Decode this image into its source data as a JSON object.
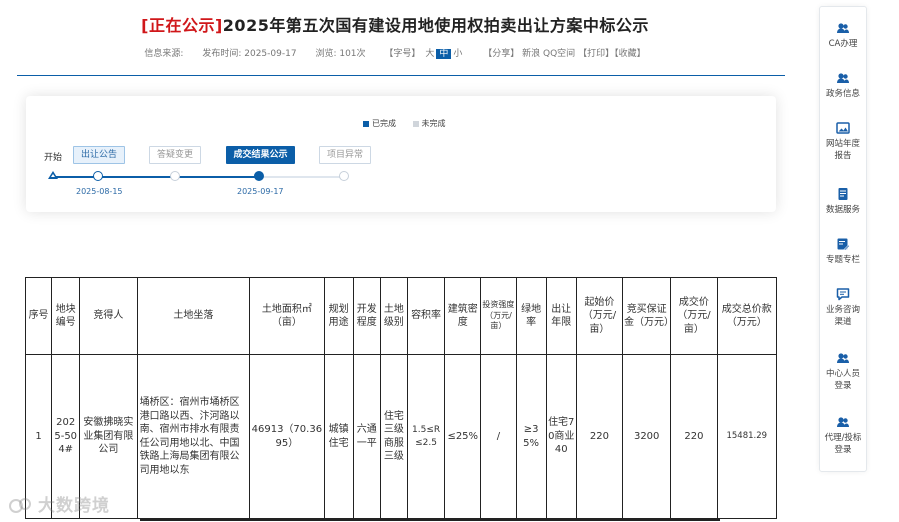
{
  "article": {
    "tag": "[正在公示]",
    "title": "2025年第五次国有建设用地使用权拍卖出让方案中标公示",
    "source_label": "信息来源:",
    "publish_label": "发布时间:",
    "publish_date": "2025-09-17",
    "views_label": "浏览:",
    "views": "101次",
    "font_size_label": "【字号】",
    "font_large": "大",
    "font_medium": "中",
    "font_small": "小",
    "share_label": "【分享】",
    "share_sina": "新浪",
    "share_qq": "QQ空间",
    "print_label": "【打印】",
    "fav_label": "【收藏】"
  },
  "progress": {
    "legend_done": "已完成",
    "legend_todo": "未完成",
    "start_label": "开始",
    "steps": [
      {
        "label": "出让公告",
        "state": "done",
        "date": "2025-08-15"
      },
      {
        "label": "答疑变更",
        "state": "todo",
        "date": ""
      },
      {
        "label": "成交结果公示",
        "state": "current",
        "date": "2025-09-17"
      },
      {
        "label": "项目异常",
        "state": "todo",
        "date": ""
      }
    ],
    "colors": {
      "done": "#0b5ea8",
      "todo": "#c7d0da"
    }
  },
  "table": {
    "headers": [
      "序号",
      "地块编号",
      "竞得人",
      "土地坐落",
      "土地面积㎡（亩）",
      "规划用途",
      "开发程度",
      "土地级别",
      "容积率",
      "建筑密度",
      "投资强度（万元/亩）",
      "绿地率",
      "出让年限",
      "起始价（万元/亩）",
      "竞买保证金（万元）",
      "成交价（万元/亩）",
      "成交总价款（万元）"
    ],
    "rows": [
      [
        "1",
        "2025-504#",
        "安徽拂晓实业集团有限公司",
        "埇桥区：宿州市埇桥区港口路以西、汴河路以南、宿州市排水有限责任公司用地以北、中国铁路上海局集团有限公司用地以东",
        "46913（70.3695）",
        "城镇住宅",
        "六通一平",
        "住宅三级商服三级",
        "1.5≤R≤2.5",
        "≤25%",
        "/",
        "≥35%",
        "住宅70商业40",
        "220",
        "3200",
        "220",
        "15481.29"
      ]
    ]
  },
  "sidebar": {
    "items": [
      {
        "label": "CA办理",
        "icon": "user-group-icon"
      },
      {
        "label": "政务信息",
        "icon": "user-group-icon"
      },
      {
        "label": "网站年度报告",
        "icon": "image-icon"
      },
      {
        "label": "数据服务",
        "icon": "document-icon"
      },
      {
        "label": "专题专栏",
        "icon": "edit-doc-icon"
      },
      {
        "label": "业务咨询渠道",
        "icon": "chat-icon"
      },
      {
        "label": "中心人员登录",
        "icon": "user-group-icon"
      },
      {
        "label": "代理/投标登录",
        "icon": "user-group-icon"
      }
    ]
  },
  "watermark": {
    "text": "大数跨境"
  }
}
